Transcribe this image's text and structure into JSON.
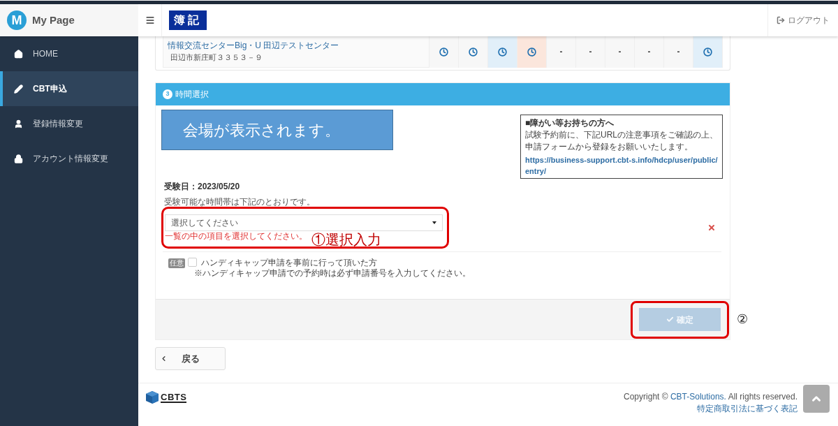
{
  "header": {
    "logo_letter": "M",
    "title": "My Page",
    "badge": "簿記",
    "logout": "ログアウト"
  },
  "sidebar": {
    "items": [
      {
        "label": "HOME",
        "selected": false
      },
      {
        "label": "CBT申込",
        "selected": true
      },
      {
        "label": "登録情報変更",
        "selected": false
      },
      {
        "label": "アカウント情報変更",
        "selected": false
      }
    ]
  },
  "venue": {
    "name": "情報交流センターBig・U 田辺テストセンター",
    "address": "田辺市新庄町３３５３－９",
    "slots": [
      {
        "kind": "clock",
        "color": "#f7f7f7"
      },
      {
        "kind": "clock",
        "color": "#f7f7f7"
      },
      {
        "kind": "clock",
        "color": "#e1eff9"
      },
      {
        "kind": "clock",
        "color": "#fbe6dc"
      },
      {
        "kind": "dash",
        "text": "-",
        "color": "#f7f7f7"
      },
      {
        "kind": "dash",
        "text": "-",
        "color": "#f7f7f7"
      },
      {
        "kind": "dash",
        "text": "-",
        "color": "#f7f7f7"
      },
      {
        "kind": "dash",
        "text": "-",
        "color": "#f7f7f7"
      },
      {
        "kind": "dash",
        "text": "-",
        "color": "#f7f7f7"
      },
      {
        "kind": "clock",
        "color": "#e1eff9"
      }
    ]
  },
  "section": {
    "number": "3",
    "title": "時間選択"
  },
  "banner": "会場が表示されます。",
  "notice": {
    "title": "■障がい等お持ちの方へ",
    "body": "試験予約前に、下記URLの注意事項をご確認の上、申請フォームから登録をお願いいたします。",
    "link": "https://business-support.cbt-s.info/hdcp/user/public/entry/"
  },
  "exam_date": "受験日：2023/05/20",
  "hint": "受験可能な時間帯は下記のとおりです。",
  "select": {
    "placeholder": "選択してください",
    "error": "一覧の中の項目を選択してください。"
  },
  "step1_label": "①選択入力",
  "handicap": {
    "badge": "任意",
    "checked": false,
    "label": "ハンディキャップ申請を事前に行って頂いた方",
    "note": "※ハンディキャップ申請での予約時は必ず申請番号を入力してください。"
  },
  "confirm": {
    "label": "確定",
    "disabled": true
  },
  "step2_label": "②",
  "back": "戻る",
  "footer": {
    "logo": "CBTS",
    "copyright_prefix": "Copyright © ",
    "company": "CBT-Solutions.",
    "rights": " All rights reserved.",
    "legal_link": "特定商取引法に基づく表記"
  }
}
